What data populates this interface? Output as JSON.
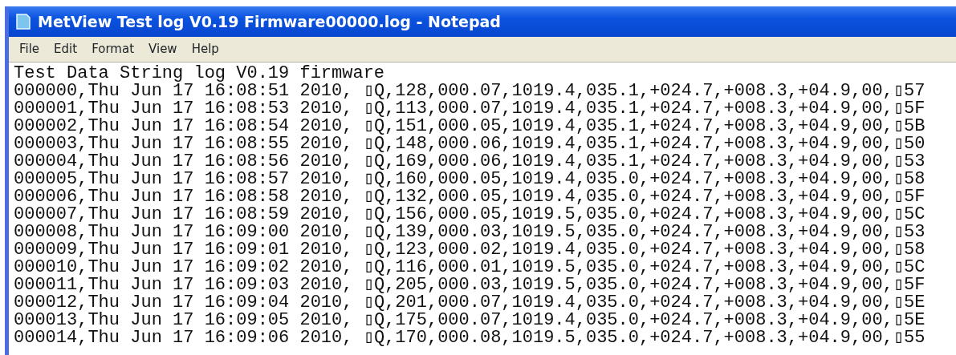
{
  "window": {
    "title": "MetView Test log V0.19 Firmware00000.log - Notepad"
  },
  "menu": [
    "File",
    "Edit",
    "Format",
    "View",
    "Help"
  ],
  "lines": [
    "Test Data String log V0.19 firmware",
    "000000,Thu Jun 17 16:08:51 2010, ▯Q,128,000.07,1019.4,035.1,+024.7,+008.3,+04.9,00,▯57",
    "000001,Thu Jun 17 16:08:53 2010, ▯Q,113,000.07,1019.4,035.1,+024.7,+008.3,+04.9,00,▯5F",
    "000002,Thu Jun 17 16:08:54 2010, ▯Q,151,000.05,1019.4,035.1,+024.7,+008.3,+04.9,00,▯5B",
    "000003,Thu Jun 17 16:08:55 2010, ▯Q,148,000.06,1019.4,035.1,+024.7,+008.3,+04.9,00,▯50",
    "000004,Thu Jun 17 16:08:56 2010, ▯Q,169,000.06,1019.4,035.1,+024.7,+008.3,+04.9,00,▯53",
    "000005,Thu Jun 17 16:08:57 2010, ▯Q,160,000.05,1019.4,035.0,+024.7,+008.3,+04.9,00,▯58",
    "000006,Thu Jun 17 16:08:58 2010, ▯Q,132,000.05,1019.4,035.0,+024.7,+008.3,+04.9,00,▯5F",
    "000007,Thu Jun 17 16:08:59 2010, ▯Q,156,000.05,1019.5,035.0,+024.7,+008.3,+04.9,00,▯5C",
    "000008,Thu Jun 17 16:09:00 2010, ▯Q,139,000.03,1019.5,035.0,+024.7,+008.3,+04.9,00,▯53",
    "000009,Thu Jun 17 16:09:01 2010, ▯Q,123,000.02,1019.4,035.0,+024.7,+008.3,+04.9,00,▯58",
    "000010,Thu Jun 17 16:09:02 2010, ▯Q,116,000.01,1019.5,035.0,+024.7,+008.3,+04.9,00,▯5C",
    "000011,Thu Jun 17 16:09:03 2010, ▯Q,205,000.03,1019.5,035.0,+024.7,+008.3,+04.9,00,▯5F",
    "000012,Thu Jun 17 16:09:04 2010, ▯Q,201,000.07,1019.4,035.0,+024.7,+008.3,+04.9,00,▯5E",
    "000013,Thu Jun 17 16:09:05 2010, ▯Q,175,000.07,1019.4,035.0,+024.7,+008.3,+04.9,00,▯5E",
    "000014,Thu Jun 17 16:09:06 2010, ▯Q,170,000.08,1019.5,035.0,+024.7,+008.3,+04.9,00,▯55"
  ]
}
